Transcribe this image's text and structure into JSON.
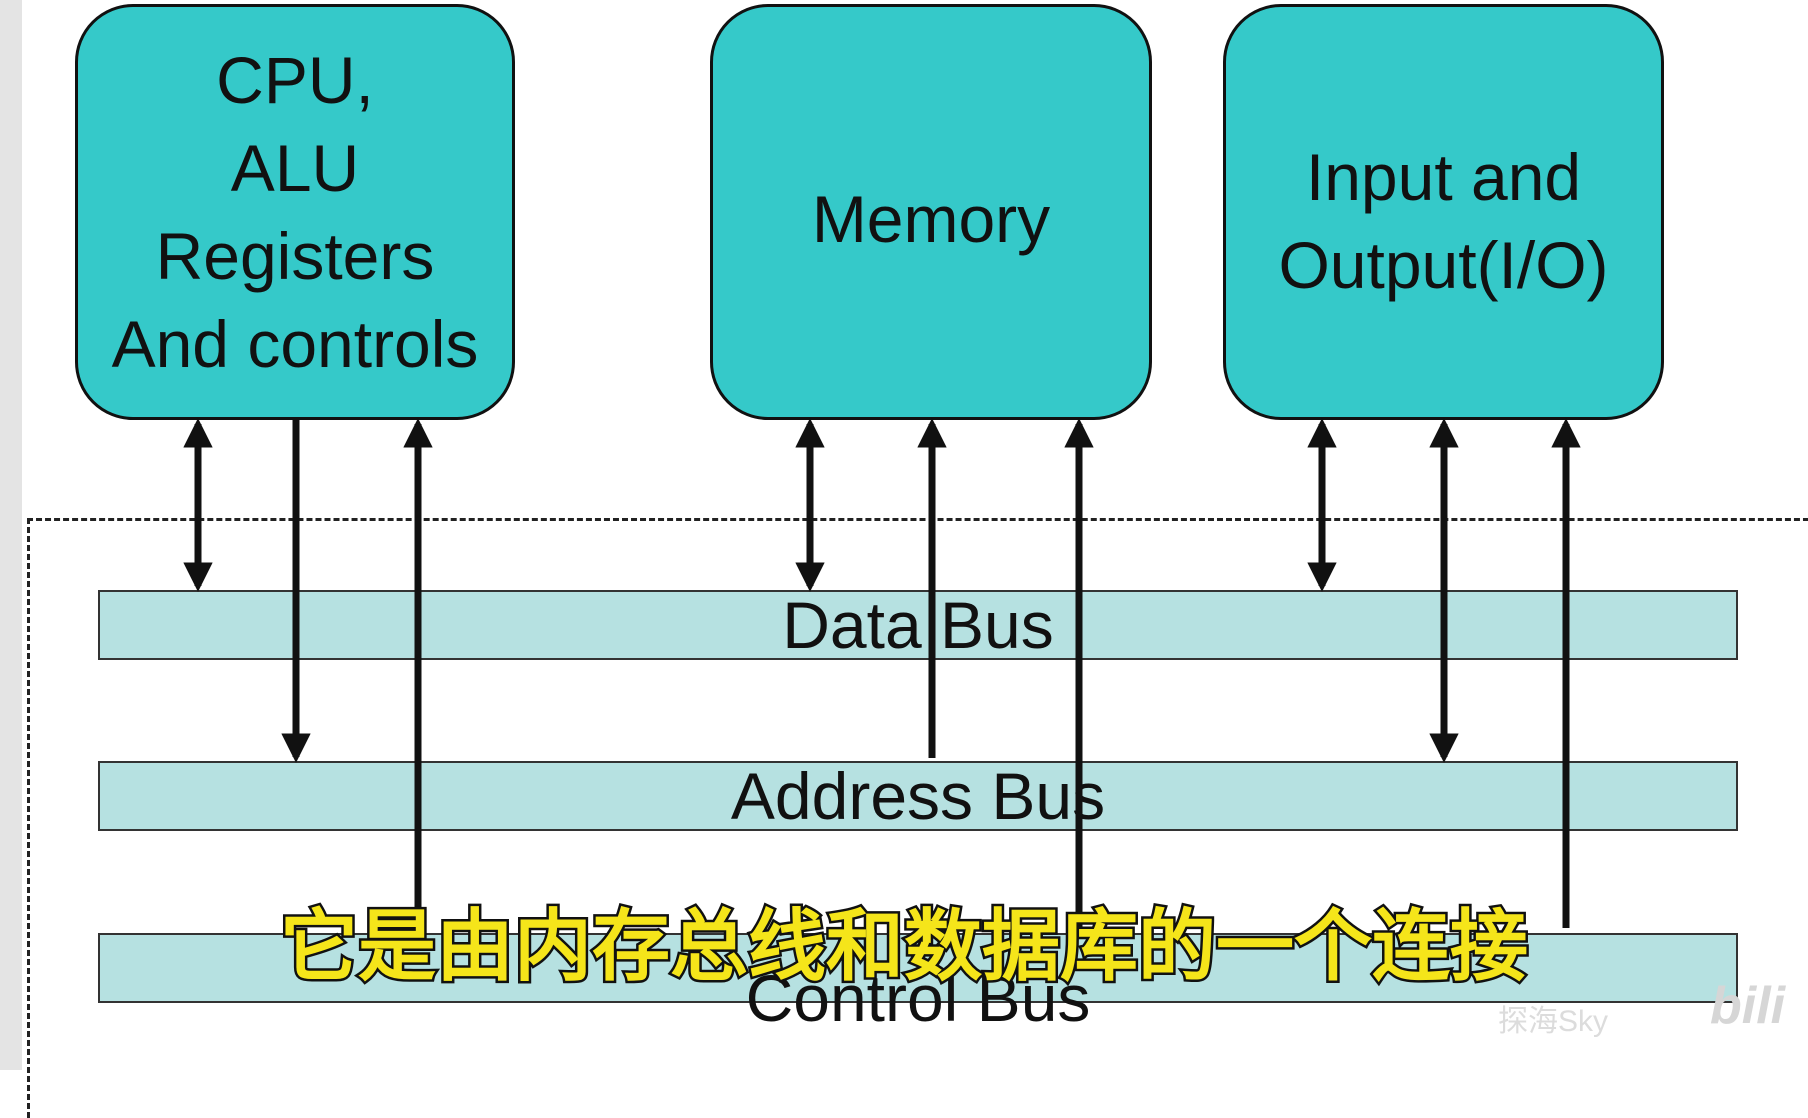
{
  "components": {
    "cpu": [
      "CPU,",
      "ALU",
      "Registers",
      "And controls"
    ],
    "memory": [
      "Memory"
    ],
    "io": [
      "Input and",
      "Output(I/O)"
    ]
  },
  "buses": {
    "data": "Data Bus",
    "address": "Address Bus",
    "control": "Control Bus"
  },
  "subtitle": "它是由内存总线和数据库的一个连接",
  "watermark": "探海Sky",
  "logo": "bili",
  "colors": {
    "component_fill": "#35c9c9",
    "bus_fill": "#b6e1e1",
    "subtitle_text": "#f5e51a"
  }
}
